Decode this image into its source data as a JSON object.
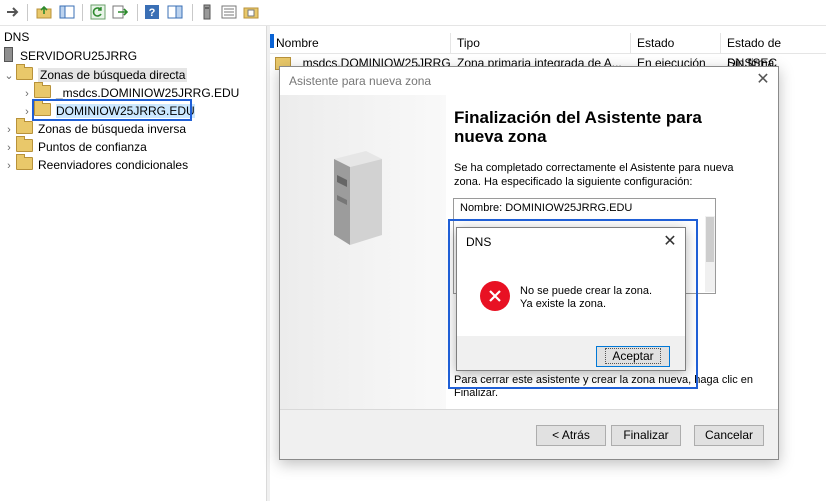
{
  "toolbar": {
    "icons": [
      "back-arrow-icon",
      "folder-up-icon",
      "show-tree-icon",
      "refresh-icon",
      "export-icon",
      "help-icon",
      "show-pane-icon",
      "server-icon",
      "list-icon",
      "zone-folder-icon"
    ]
  },
  "tree": {
    "root": "DNS",
    "server": "SERVIDORU25JRRG",
    "forward_zones": "Zonas de búsqueda directa",
    "msdcs_zone": "_msdcs.DOMINIOW25JRRG.EDU",
    "selected_zone": "DOMINIOW25JRRG.EDU",
    "reverse_zones": "Zonas de búsqueda inversa",
    "trust_points": "Puntos de confianza",
    "conditional_forwarders": "Reenviadores condicionales"
  },
  "list": {
    "columns": [
      "Nombre",
      "Tipo",
      "Estado",
      "Estado de DNSSEC"
    ],
    "row": [
      "_msdcs.DOMINIOW25JRRG",
      "Zona primaria integrada de A...",
      "En ejecución",
      "Sin firma"
    ]
  },
  "wizard": {
    "title": "Asistente para nueva zona",
    "heading": "Finalización del Asistente para nueva zona",
    "intro": "Se ha completado correctamente el Asistente para nueva zona. Ha especificado la siguiente configuración:",
    "summary": "Nombre:  DOMINIOW25JRRG.EDU",
    "hidden_text": "Para cerrar este asistente y crear la zona nueva, haga clic en Finalizar.",
    "back": "< Atrás",
    "finish": "Finalizar",
    "cancel": "Cancelar"
  },
  "dialog": {
    "title": "DNS",
    "message_line1": "No se puede crear la zona.",
    "message_line2": "Ya existe la zona.",
    "ok": "Aceptar"
  },
  "colors": {
    "highlight": "#1f5fd6",
    "error": "#e81123",
    "selection": "#cce8ff"
  }
}
